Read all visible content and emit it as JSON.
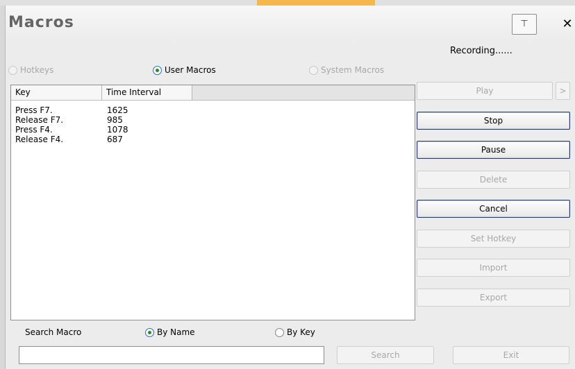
{
  "window": {
    "title": "Macros",
    "pin_glyph": "⊤",
    "close_glyph": "✕"
  },
  "status_text": "Recording......",
  "macro_type": {
    "options": [
      {
        "label": "Hotkeys",
        "checked": false,
        "enabled": false
      },
      {
        "label": "User Macros",
        "checked": true,
        "enabled": true
      },
      {
        "label": "System Macros",
        "checked": false,
        "enabled": false
      }
    ]
  },
  "table": {
    "columns": [
      "Key",
      "Time Interval"
    ],
    "rows": [
      {
        "key": "Press F7.",
        "time": "1625"
      },
      {
        "key": "Release F7.",
        "time": "985"
      },
      {
        "key": "Press F4.",
        "time": "1078"
      },
      {
        "key": "Release F4.",
        "time": "687"
      }
    ]
  },
  "buttons": {
    "play": "Play",
    "more": ">",
    "stop": "Stop",
    "pause": "Pause",
    "delete": "Delete",
    "cancel": "Cancel",
    "set_hotkey": "Set Hotkey",
    "import": "Import",
    "export": "Export",
    "search": "Search",
    "exit": "Exit"
  },
  "search": {
    "label": "Search Macro",
    "value": "",
    "placeholder": "",
    "by_name": {
      "label": "By Name",
      "checked": true
    },
    "by_key": {
      "label": "By Key",
      "checked": false
    }
  },
  "colors": {
    "enabled_border": "#2b3a6b",
    "disabled_text": "#a8a8a8",
    "radio_dot": "#2a8a2a"
  }
}
